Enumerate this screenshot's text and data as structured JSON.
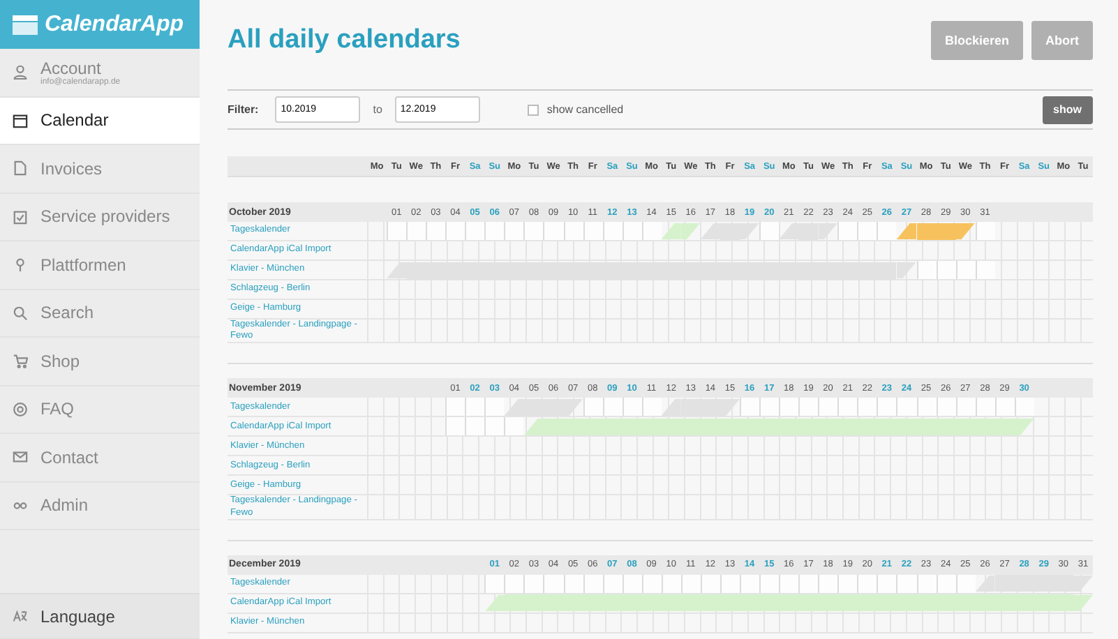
{
  "app": {
    "name": "CalendarApp"
  },
  "sidebar": {
    "items": [
      {
        "label": "Account",
        "sub": "info@calendarapp.de",
        "selected": false
      },
      {
        "label": "Calendar",
        "selected": true
      },
      {
        "label": "Invoices",
        "selected": false
      },
      {
        "label": "Service providers",
        "selected": false
      },
      {
        "label": "Plattformen",
        "selected": false
      },
      {
        "label": "Search",
        "selected": false
      },
      {
        "label": "Shop",
        "selected": false
      },
      {
        "label": "FAQ",
        "selected": false
      },
      {
        "label": "Contact",
        "selected": false
      },
      {
        "label": "Admin",
        "selected": false
      }
    ],
    "language": "Language"
  },
  "page": {
    "title": "All daily calendars",
    "buttons": [
      "Blockieren",
      "Abort"
    ]
  },
  "filter": {
    "label": "Filter:",
    "from": "10.2019",
    "to_label": "to",
    "to": "12.2019",
    "show_cancelled": {
      "label": "show cancelled",
      "checked": false
    },
    "button": "show"
  },
  "weekdays": [
    {
      "label": "Mo",
      "weekend": false
    },
    {
      "label": "Tu",
      "weekend": false
    },
    {
      "label": "We",
      "weekend": false
    },
    {
      "label": "Th",
      "weekend": false
    },
    {
      "label": "Fr",
      "weekend": false
    },
    {
      "label": "Sa",
      "weekend": true
    },
    {
      "label": "Su",
      "weekend": true
    },
    {
      "label": "Mo",
      "weekend": false
    },
    {
      "label": "Tu",
      "weekend": false
    },
    {
      "label": "We",
      "weekend": false
    },
    {
      "label": "Th",
      "weekend": false
    },
    {
      "label": "Fr",
      "weekend": false
    },
    {
      "label": "Sa",
      "weekend": true
    },
    {
      "label": "Su",
      "weekend": true
    },
    {
      "label": "Mo",
      "weekend": false
    },
    {
      "label": "Tu",
      "weekend": false
    },
    {
      "label": "We",
      "weekend": false
    },
    {
      "label": "Th",
      "weekend": false
    },
    {
      "label": "Fr",
      "weekend": false
    },
    {
      "label": "Sa",
      "weekend": true
    },
    {
      "label": "Su",
      "weekend": true
    },
    {
      "label": "Mo",
      "weekend": false
    },
    {
      "label": "Tu",
      "weekend": false
    },
    {
      "label": "We",
      "weekend": false
    },
    {
      "label": "Th",
      "weekend": false
    },
    {
      "label": "Fr",
      "weekend": false
    },
    {
      "label": "Sa",
      "weekend": true
    },
    {
      "label": "Su",
      "weekend": true
    },
    {
      "label": "Mo",
      "weekend": false
    },
    {
      "label": "Tu",
      "weekend": false
    },
    {
      "label": "We",
      "weekend": false
    },
    {
      "label": "Th",
      "weekend": false
    },
    {
      "label": "Fr",
      "weekend": false
    },
    {
      "label": "Sa",
      "weekend": true
    },
    {
      "label": "Su",
      "weekend": true
    },
    {
      "label": "Mo",
      "weekend": false
    },
    {
      "label": "Tu",
      "weekend": false
    }
  ],
  "months": [
    {
      "title": "October 2019",
      "days": [
        "01",
        "02",
        "03",
        "04",
        "05",
        "06",
        "07",
        "08",
        "09",
        "10",
        "11",
        "12",
        "13",
        "14",
        "15",
        "16",
        "17",
        "18",
        "19",
        "20",
        "21",
        "22",
        "23",
        "24",
        "25",
        "26",
        "27",
        "28",
        "29",
        "30",
        "31"
      ],
      "calendars": [
        {
          "name": "Tageskalender",
          "cells": [
            {
              "kind": "free"
            },
            {
              "kind": "free"
            },
            {
              "kind": "free"
            },
            {
              "kind": "free"
            },
            {
              "kind": "free"
            },
            {
              "kind": "free"
            },
            {
              "kind": "free"
            },
            {
              "kind": "free"
            },
            {
              "kind": "free"
            },
            {
              "kind": "free"
            },
            {
              "kind": "free"
            },
            {
              "kind": "free"
            },
            {
              "kind": "free"
            },
            {
              "kind": "free"
            },
            {
              "kind": "booked"
            },
            {
              "kind": "booked"
            },
            {
              "kind": "blocked"
            },
            {
              "kind": "blocked"
            },
            {
              "kind": "blocked"
            },
            {
              "kind": "free"
            },
            {
              "kind": "blocked"
            },
            {
              "kind": "blocked"
            },
            {
              "kind": "blocked"
            },
            {
              "kind": "free"
            },
            {
              "kind": "free"
            },
            {
              "kind": "free"
            },
            {
              "kind": "pending"
            },
            {
              "kind": "pending"
            },
            {
              "kind": "pending"
            },
            {
              "kind": "pending"
            },
            {
              "kind": "free"
            }
          ]
        },
        {
          "name": "CalendarApp iCal Import"
        },
        {
          "name": "Klavier - München",
          "cells": [
            {
              "kind": "blocked"
            },
            {
              "kind": "blocked"
            },
            {
              "kind": "blocked"
            },
            {
              "kind": "blocked"
            },
            {
              "kind": "blocked"
            },
            {
              "kind": "blocked"
            },
            {
              "kind": "blocked"
            },
            {
              "kind": "blocked"
            },
            {
              "kind": "blocked"
            },
            {
              "kind": "blocked"
            },
            {
              "kind": "blocked"
            },
            {
              "kind": "blocked"
            },
            {
              "kind": "blocked"
            },
            {
              "kind": "blocked"
            },
            {
              "kind": "blocked"
            },
            {
              "kind": "blocked"
            },
            {
              "kind": "blocked"
            },
            {
              "kind": "blocked"
            },
            {
              "kind": "blocked"
            },
            {
              "kind": "blocked"
            },
            {
              "kind": "blocked"
            },
            {
              "kind": "blocked"
            },
            {
              "kind": "blocked"
            },
            {
              "kind": "blocked"
            },
            {
              "kind": "blocked"
            },
            {
              "kind": "blocked"
            },
            {
              "kind": "blocked"
            },
            {
              "kind": "free"
            },
            {
              "kind": "free"
            },
            {
              "kind": "free"
            },
            {
              "kind": "free"
            }
          ]
        },
        {
          "name": "Schlagzeug - Berlin"
        },
        {
          "name": "Geige - Hamburg"
        },
        {
          "name": "Tageskalender - Landingpage - Fewo"
        }
      ]
    },
    {
      "title": "November 2019",
      "days": [
        "01",
        "02",
        "03",
        "04",
        "05",
        "06",
        "07",
        "08",
        "09",
        "10",
        "11",
        "12",
        "13",
        "14",
        "15",
        "16",
        "17",
        "18",
        "19",
        "20",
        "21",
        "22",
        "23",
        "24",
        "25",
        "26",
        "27",
        "28",
        "29",
        "30"
      ],
      "calendars": [
        {
          "name": "Tageskalender",
          "cells": [
            {
              "kind": "free"
            },
            {
              "kind": "free"
            },
            {
              "kind": "free"
            },
            {
              "kind": "blocked"
            },
            {
              "kind": "blocked"
            },
            {
              "kind": "blocked"
            },
            {
              "kind": "blocked"
            },
            {
              "kind": "free"
            },
            {
              "kind": "free"
            },
            {
              "kind": "free"
            },
            {
              "kind": "free"
            },
            {
              "kind": "blocked"
            },
            {
              "kind": "blocked"
            },
            {
              "kind": "blocked"
            },
            {
              "kind": "blocked"
            },
            {
              "kind": "free"
            },
            {
              "kind": "free"
            },
            {
              "kind": "free"
            },
            {
              "kind": "free"
            },
            {
              "kind": "free"
            },
            {
              "kind": "free"
            },
            {
              "kind": "free"
            },
            {
              "kind": "free"
            },
            {
              "kind": "free"
            },
            {
              "kind": "free"
            },
            {
              "kind": "free"
            },
            {
              "kind": "free"
            },
            {
              "kind": "free"
            },
            {
              "kind": "free"
            },
            {
              "kind": "free"
            }
          ]
        },
        {
          "name": "CalendarApp iCal Import",
          "cells": [
            {
              "kind": "free"
            },
            {
              "kind": "free"
            },
            {
              "kind": "free"
            },
            {
              "kind": "free"
            },
            {
              "kind": "booked"
            },
            {
              "kind": "booked"
            },
            {
              "kind": "booked"
            },
            {
              "kind": "booked"
            },
            {
              "kind": "booked"
            },
            {
              "kind": "booked"
            },
            {
              "kind": "booked"
            },
            {
              "kind": "booked"
            },
            {
              "kind": "booked"
            },
            {
              "kind": "booked"
            },
            {
              "kind": "booked"
            },
            {
              "kind": "booked"
            },
            {
              "kind": "booked"
            },
            {
              "kind": "booked"
            },
            {
              "kind": "booked"
            },
            {
              "kind": "booked"
            },
            {
              "kind": "booked"
            },
            {
              "kind": "booked"
            },
            {
              "kind": "booked"
            },
            {
              "kind": "booked"
            },
            {
              "kind": "booked"
            },
            {
              "kind": "booked"
            },
            {
              "kind": "booked"
            },
            {
              "kind": "booked"
            },
            {
              "kind": "booked"
            },
            {
              "kind": "booked"
            }
          ]
        },
        {
          "name": "Klavier - München"
        },
        {
          "name": "Schlagzeug - Berlin"
        },
        {
          "name": "Geige - Hamburg"
        },
        {
          "name": "Tageskalender - Landingpage - Fewo"
        }
      ]
    },
    {
      "title": "December 2019",
      "days": [
        "01",
        "02",
        "03",
        "04",
        "05",
        "06",
        "07",
        "08",
        "09",
        "10",
        "11",
        "12",
        "13",
        "14",
        "15",
        "16",
        "17",
        "18",
        "19",
        "20",
        "21",
        "22",
        "23",
        "24",
        "25",
        "26",
        "27",
        "28",
        "29",
        "30",
        "31"
      ],
      "calendars": [
        {
          "name": "Tageskalender",
          "cells": [
            {
              "kind": "free"
            },
            {
              "kind": "free"
            },
            {
              "kind": "free"
            },
            {
              "kind": "free"
            },
            {
              "kind": "free"
            },
            {
              "kind": "free"
            },
            {
              "kind": "free"
            },
            {
              "kind": "free"
            },
            {
              "kind": "free"
            },
            {
              "kind": "free"
            },
            {
              "kind": "free"
            },
            {
              "kind": "free"
            },
            {
              "kind": "free"
            },
            {
              "kind": "free"
            },
            {
              "kind": "free"
            },
            {
              "kind": "free"
            },
            {
              "kind": "free"
            },
            {
              "kind": "free"
            },
            {
              "kind": "free"
            },
            {
              "kind": "free"
            },
            {
              "kind": "free"
            },
            {
              "kind": "free"
            },
            {
              "kind": "free"
            },
            {
              "kind": "free"
            },
            {
              "kind": "free"
            },
            {
              "kind": "blocked"
            },
            {
              "kind": "blocked"
            },
            {
              "kind": "blocked"
            },
            {
              "kind": "blocked"
            },
            {
              "kind": "blocked"
            },
            {
              "kind": "blocked"
            }
          ]
        },
        {
          "name": "CalendarApp iCal Import",
          "cells": [
            {
              "kind": "booked"
            },
            {
              "kind": "booked"
            },
            {
              "kind": "booked"
            },
            {
              "kind": "booked"
            },
            {
              "kind": "booked"
            },
            {
              "kind": "booked"
            },
            {
              "kind": "booked"
            },
            {
              "kind": "booked"
            },
            {
              "kind": "booked"
            },
            {
              "kind": "booked"
            },
            {
              "kind": "booked"
            },
            {
              "kind": "booked"
            },
            {
              "kind": "booked"
            },
            {
              "kind": "booked"
            },
            {
              "kind": "booked"
            },
            {
              "kind": "booked"
            },
            {
              "kind": "booked"
            },
            {
              "kind": "booked"
            },
            {
              "kind": "booked"
            },
            {
              "kind": "booked"
            },
            {
              "kind": "booked"
            },
            {
              "kind": "booked"
            },
            {
              "kind": "booked"
            },
            {
              "kind": "booked"
            },
            {
              "kind": "booked"
            },
            {
              "kind": "booked"
            },
            {
              "kind": "booked"
            },
            {
              "kind": "booked"
            },
            {
              "kind": "booked"
            },
            {
              "kind": "booked"
            },
            {
              "kind": "booked"
            }
          ]
        },
        {
          "name": "Klavier - München"
        }
      ]
    }
  ]
}
